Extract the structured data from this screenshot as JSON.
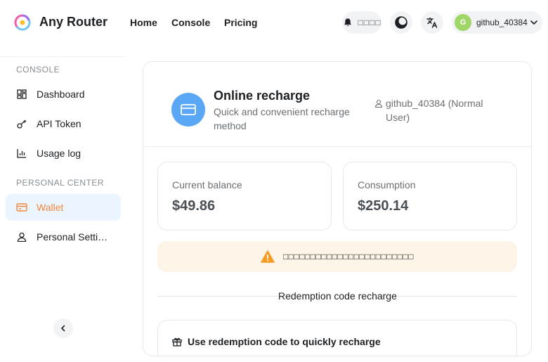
{
  "app": {
    "name": "Any Router"
  },
  "nav": [
    {
      "label": "Home"
    },
    {
      "label": "Console"
    },
    {
      "label": "Pricing"
    }
  ],
  "header": {
    "notice_label": "□□□□",
    "user": {
      "initial": "G",
      "name": "github_40384"
    }
  },
  "sidebar": {
    "section_console": "CONSOLE",
    "section_personal": "PERSONAL CENTER",
    "items": [
      {
        "label": "Dashboard",
        "icon": "dashboard-icon"
      },
      {
        "label": "API Token",
        "icon": "key-icon"
      },
      {
        "label": "Usage log",
        "icon": "chart-icon"
      },
      {
        "label": "Wallet",
        "icon": "wallet-icon",
        "active": true
      },
      {
        "label": "Personal Settings",
        "icon": "user-icon"
      }
    ]
  },
  "recharge": {
    "title": "Online recharge",
    "subtitle": "Quick and convenient recharge method",
    "user_info": "github_40384 (Normal User)",
    "balance_label": "Current balance",
    "balance_value": "$49.86",
    "consumption_label": "Consumption",
    "consumption_value": "$250.14",
    "warning_text": "□□□□□□□□□□□□□□□□□□□□□□□□",
    "divider_text": "Redemption code recharge",
    "redeem_title": "Use redemption code to quickly recharge"
  },
  "colors": {
    "accent": "#f5863a",
    "active_bg": "#eaf5ff",
    "icon_blue": "#5aa8f5",
    "warning": "#f59a23",
    "warning_bg": "#fdf4e8",
    "avatar_green": "#a0d568"
  }
}
